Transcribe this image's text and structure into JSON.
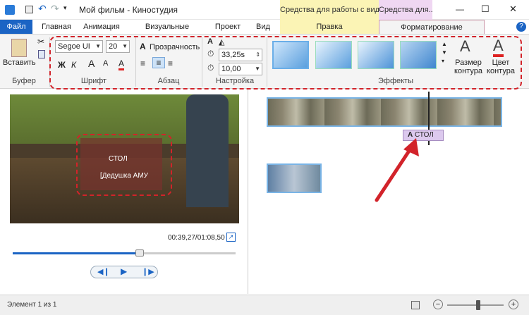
{
  "window": {
    "title": "Мой фильм - Киностудия",
    "context_tab_video": "Средства для работы с видео",
    "context_tab_text": "Средства для...",
    "controls": {
      "minimize": "—",
      "maximize": "☐",
      "close": "✕"
    },
    "help": "?"
  },
  "tabs": [
    {
      "label": "Файл"
    },
    {
      "label": "Главная"
    },
    {
      "label": "Анимация"
    },
    {
      "label": "Визуальные эффекты"
    },
    {
      "label": "Проект"
    },
    {
      "label": "Вид"
    },
    {
      "label": "Правка"
    },
    {
      "label": "Форматирование"
    }
  ],
  "ribbon": {
    "clipboard": {
      "paste_label": "Вставить",
      "group_label": "Буфер"
    },
    "font": {
      "family": "Segoe UI",
      "size": "20",
      "bold": "Ж",
      "italic": "К",
      "grow": "A",
      "shrink": "A",
      "group_label": "Шрифт"
    },
    "paragraph": {
      "transparency_label": "Прозрачность",
      "group_label": "Абзац"
    },
    "settings": {
      "start_time": "33,25s",
      "duration": "10,00",
      "group_label": "Настройка"
    },
    "effects": {
      "group_label": "Эффекты",
      "outline_size_label": "Размер контура",
      "outline_color_label": "Цвет контура"
    }
  },
  "preview": {
    "caption_line1": "СТОЛ",
    "caption_line2": "[Дедушка АМУ",
    "time": "00:39,27/01:08,50",
    "progress": 0.57
  },
  "playback": {
    "prev": "◀❙",
    "play": "▶",
    "next": "❙▶"
  },
  "timeline": {
    "caption_clip_label": "СТОЛ",
    "caption_clip_icon": "A"
  },
  "status": {
    "text": "Элемент 1 из 1",
    "zoom_minus": "−",
    "zoom_plus": "+",
    "zoom_level": 0.55
  },
  "colors": {
    "file_tab": "#1b64c4",
    "highlight": "#d2232a",
    "video_ctx": "#fbf4b5",
    "text_ctx": "#efd7f2"
  }
}
